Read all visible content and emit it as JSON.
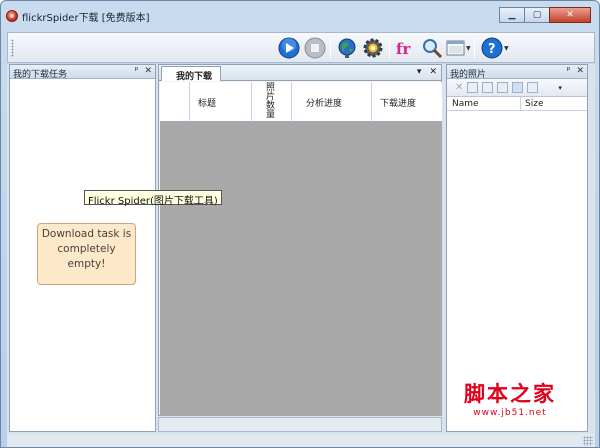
{
  "window": {
    "title": "flickrSpider下载 [免费版本]",
    "controls": {
      "minimize": "▭",
      "maximize": "□",
      "close": "✕"
    }
  },
  "toolbar": {
    "icons": [
      "play-icon",
      "stop-icon",
      "globe-icon",
      "settings-gear-icon",
      "flickr-logo-icon",
      "search-icon",
      "view-mode-icon",
      "help-icon"
    ],
    "flickr_label": "fr"
  },
  "left_panel": {
    "title": "我的下载任务",
    "pin": "ᵖ",
    "close": "✕",
    "empty_message": "Download task is completely empty!"
  },
  "center_panel": {
    "tab_label": "我的下载",
    "dropdown": "▾",
    "close": "✕",
    "columns": [
      "标题",
      "照片数量",
      "分析进度",
      "下载进度"
    ]
  },
  "right_panel": {
    "title": "我的照片",
    "pin": "ᵖ",
    "close": "✕",
    "columns": [
      "Name",
      "Size"
    ]
  },
  "tooltip": {
    "text": "Flickr Spider(图片下载工具)"
  },
  "watermark": {
    "main": "脚本之家",
    "url": "www.jb51.net"
  },
  "colors": {
    "accent": "#1f6fd1",
    "watermark": "#e0001a",
    "note_bg": "#fde9c9",
    "grid_bg": "#a9a9a9"
  }
}
